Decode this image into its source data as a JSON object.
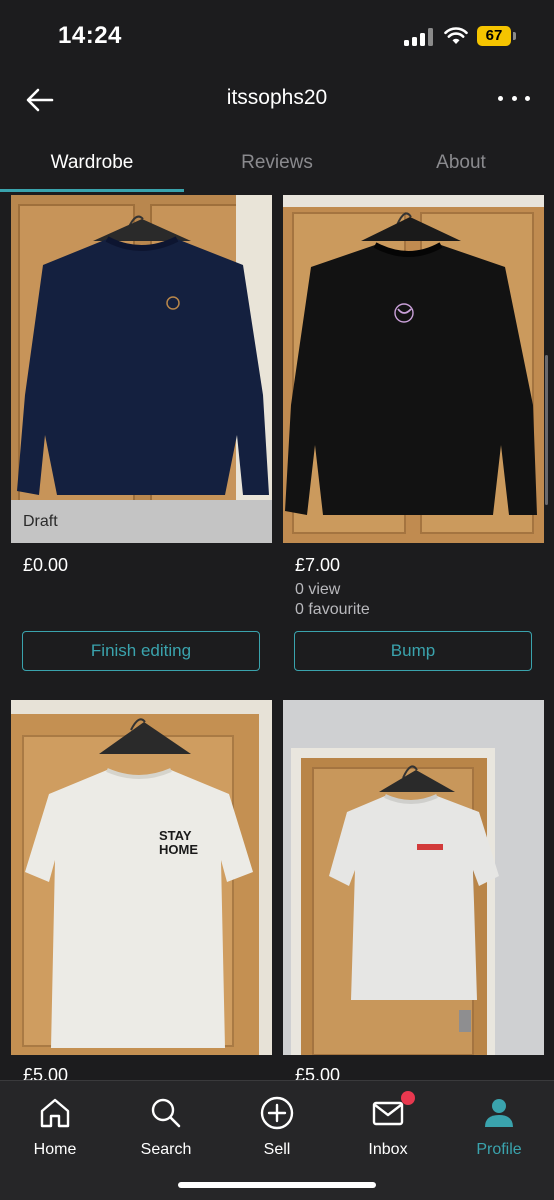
{
  "status_bar": {
    "time": "14:24",
    "battery": "67"
  },
  "header": {
    "title": "itssophs20"
  },
  "tabs": [
    {
      "label": "Wardrobe"
    },
    {
      "label": "Reviews"
    },
    {
      "label": "About"
    }
  ],
  "items": [
    {
      "status": "Draft",
      "price": "£0.00",
      "button": "Finish editing",
      "garment": "sweatshirt",
      "garment_color": "#14203f"
    },
    {
      "price": "£7.00",
      "views": "0 view",
      "favourites": "0 favourite",
      "button": "Bump",
      "garment": "sweatshirt",
      "garment_color": "#121212"
    },
    {
      "price": "£5.00",
      "garment": "t-shirt",
      "garment_color": "#ecebe6",
      "print_text": "STAY HOME"
    },
    {
      "price": "£5.00",
      "garment": "t-shirt",
      "garment_color": "#e6e6e4"
    }
  ],
  "nav": [
    {
      "label": "Home",
      "icon": "home-icon"
    },
    {
      "label": "Search",
      "icon": "search-icon"
    },
    {
      "label": "Sell",
      "icon": "plus-circle-icon"
    },
    {
      "label": "Inbox",
      "icon": "mail-icon",
      "badge": true
    },
    {
      "label": "Profile",
      "icon": "profile-icon",
      "active": true
    }
  ],
  "colors": {
    "accent": "#3aa3ad",
    "background": "#1c1c1e",
    "badge": "#e8384f"
  }
}
